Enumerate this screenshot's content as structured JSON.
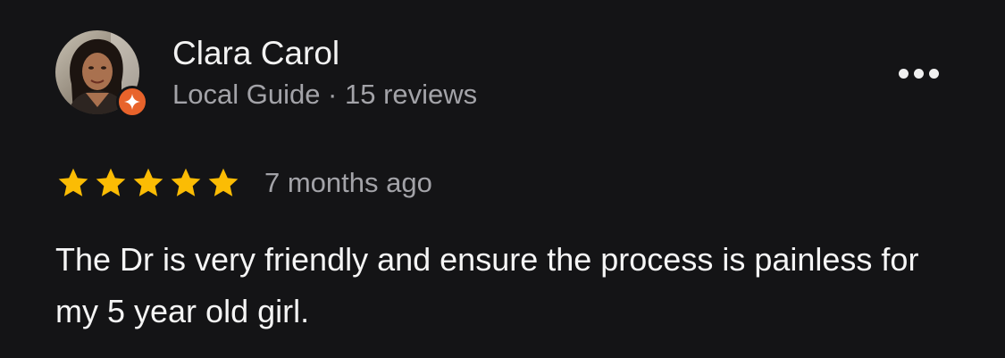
{
  "reviewer": {
    "name": "Clara Carol",
    "meta": "Local Guide · 15 reviews",
    "avatar_icon": "user-avatar-photo",
    "badge_icon": "local-guide-star-icon",
    "badge_color": "#e8632b"
  },
  "review": {
    "rating": 5,
    "rating_max": 5,
    "star_color": "#fbbc04",
    "time": "7 months ago",
    "text": "The Dr is very friendly and ensure the process is painless for my 5 year old girl."
  },
  "actions": {
    "more_icon": "more-options-icon"
  }
}
